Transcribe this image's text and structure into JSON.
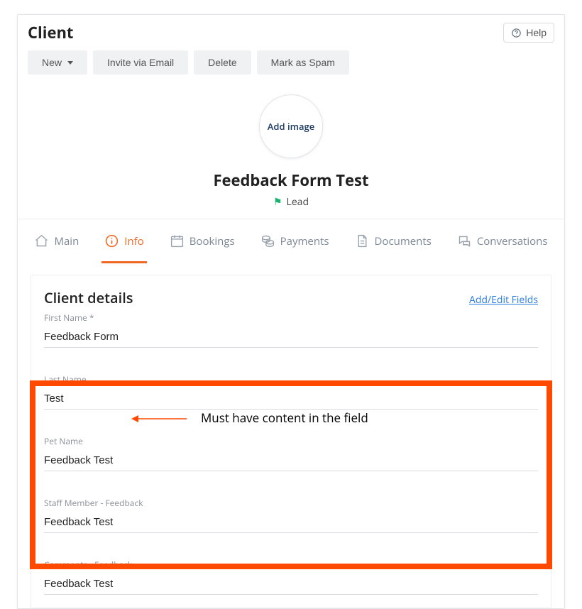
{
  "header": {
    "title": "Client",
    "help_label": "Help"
  },
  "toolbar": {
    "new_label": "New",
    "invite_label": "Invite via Email",
    "delete_label": "Delete",
    "spam_label": "Mark as Spam"
  },
  "profile": {
    "avatar_label": "Add image",
    "name": "Feedback Form Test",
    "status_label": "Lead"
  },
  "tabs": {
    "main": "Main",
    "info": "Info",
    "bookings": "Bookings",
    "payments": "Payments",
    "documents": "Documents",
    "conversations": "Conversations"
  },
  "details": {
    "heading": "Client details",
    "add_edit": "Add/Edit Fields",
    "fields": {
      "first_name": {
        "label": "First Name *",
        "value": "Feedback Form"
      },
      "last_name": {
        "label": "Last Name",
        "value": "Test"
      },
      "pet_name": {
        "label": "Pet Name",
        "value": "Feedback Test"
      },
      "staff": {
        "label": "Staff Member - Feedback",
        "value": "Feedback Test"
      },
      "comments": {
        "label": "Comments - Feedback",
        "value": "Feedback Test"
      }
    }
  },
  "annotation": {
    "text": "Must have content in the field"
  },
  "colors": {
    "accent": "#f26722",
    "highlight": "#ff4800",
    "link": "#2a7de1",
    "flag": "#18b36a"
  }
}
